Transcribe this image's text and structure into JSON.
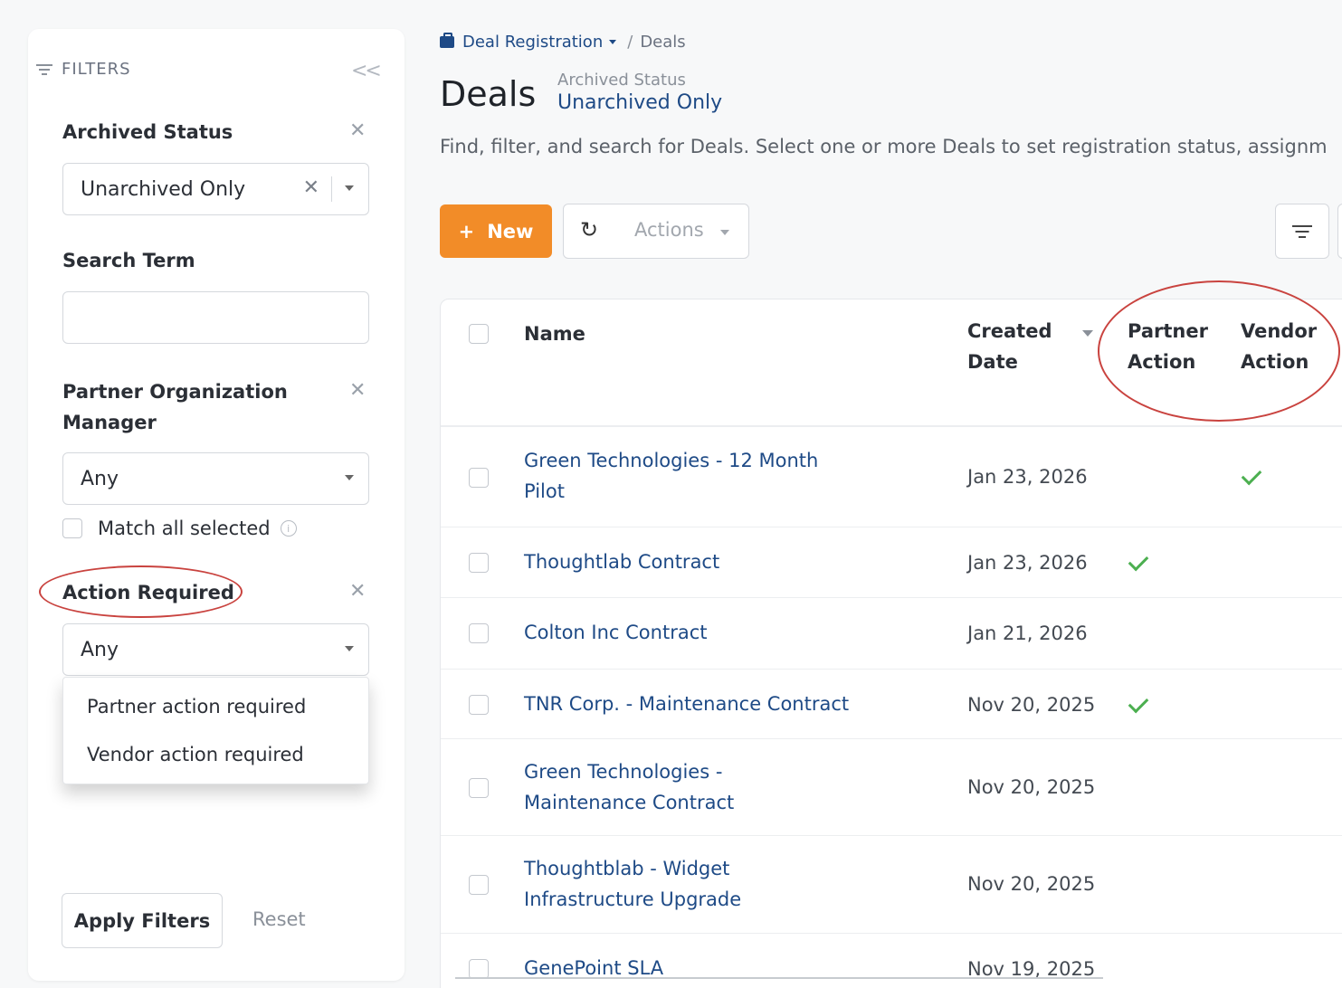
{
  "filters": {
    "header": "FILTERS",
    "archived": {
      "label": "Archived Status",
      "value": "Unarchived Only"
    },
    "search": {
      "label": "Search Term",
      "value": ""
    },
    "partner_manager": {
      "label_line1": "Partner Organization",
      "label_line2": "Manager",
      "value": "Any",
      "match_all": "Match all selected"
    },
    "action_required": {
      "label": "Action Required",
      "value": "Any",
      "options": [
        "Partner action required",
        "Vendor action required"
      ]
    },
    "apply": "Apply Filters",
    "reset": "Reset"
  },
  "breadcrumb": {
    "parent": "Deal Registration",
    "current": "Deals"
  },
  "page": {
    "title": "Deals",
    "status_label": "Archived Status",
    "status_value": "Unarchived Only",
    "description": "Find, filter, and search for Deals. Select one or more Deals to set registration status, assignm"
  },
  "toolbar": {
    "new": "New",
    "new_icon": "+",
    "actions": "Actions"
  },
  "table": {
    "headers": {
      "name": "Name",
      "created_1": "Created",
      "created_2": "Date",
      "partner_1": "Partner",
      "partner_2": "Action",
      "vendor_1": "Vendor",
      "vendor_2": "Action"
    },
    "rows": [
      {
        "name_1": "Green Technologies - 12 Month",
        "name_2": "Pilot",
        "date": "Jan 23, 2026",
        "partner_action": false,
        "vendor_action": true
      },
      {
        "name_1": "Thoughtlab Contract",
        "name_2": "",
        "date": "Jan 23, 2026",
        "partner_action": true,
        "vendor_action": false
      },
      {
        "name_1": "Colton Inc Contract",
        "name_2": "",
        "date": "Jan 21, 2026",
        "partner_action": false,
        "vendor_action": false
      },
      {
        "name_1": "TNR Corp. - Maintenance Contract",
        "name_2": "",
        "date": "Nov 20, 2025",
        "partner_action": true,
        "vendor_action": false
      },
      {
        "name_1": "Green Technologies -",
        "name_2": "Maintenance Contract",
        "date": "Nov 20, 2025",
        "partner_action": false,
        "vendor_action": false
      },
      {
        "name_1": "Thoughtblab - Widget",
        "name_2": "Infrastructure Upgrade",
        "date": "Nov 20, 2025",
        "partner_action": false,
        "vendor_action": false
      },
      {
        "name_1": "GenePoint SLA",
        "name_2": "",
        "date": "Nov 19, 2025",
        "partner_action": false,
        "vendor_action": false
      }
    ]
  },
  "colors": {
    "accent": "#f28c28",
    "link": "#1e4a86",
    "check": "#4caf50",
    "highlight": "#c9433f"
  }
}
